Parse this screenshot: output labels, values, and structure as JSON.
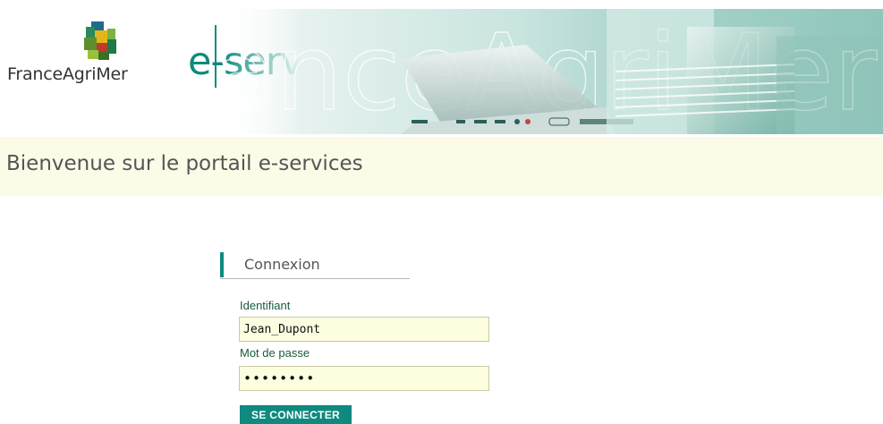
{
  "header": {
    "brand": "FranceAgriMer",
    "title": "e-services",
    "watermark": "FranceAgriMer"
  },
  "welcome": {
    "title": "Bienvenue sur le portail e-services"
  },
  "login": {
    "heading": "Connexion",
    "username_label": "Identifiant",
    "username_value": "Jean_Dupont",
    "password_label": "Mot de passe",
    "password_value": "••••••••",
    "submit_label": "SE CONNECTER"
  },
  "colors": {
    "accent": "#0e8a7f",
    "welcome_band": "#fbfbe8",
    "input_background": "#fdfde0",
    "label_text": "#1b5b3b"
  },
  "icons": {
    "logo": "franceagrimer-logo-mark",
    "banner": "laptop-documents-image"
  }
}
